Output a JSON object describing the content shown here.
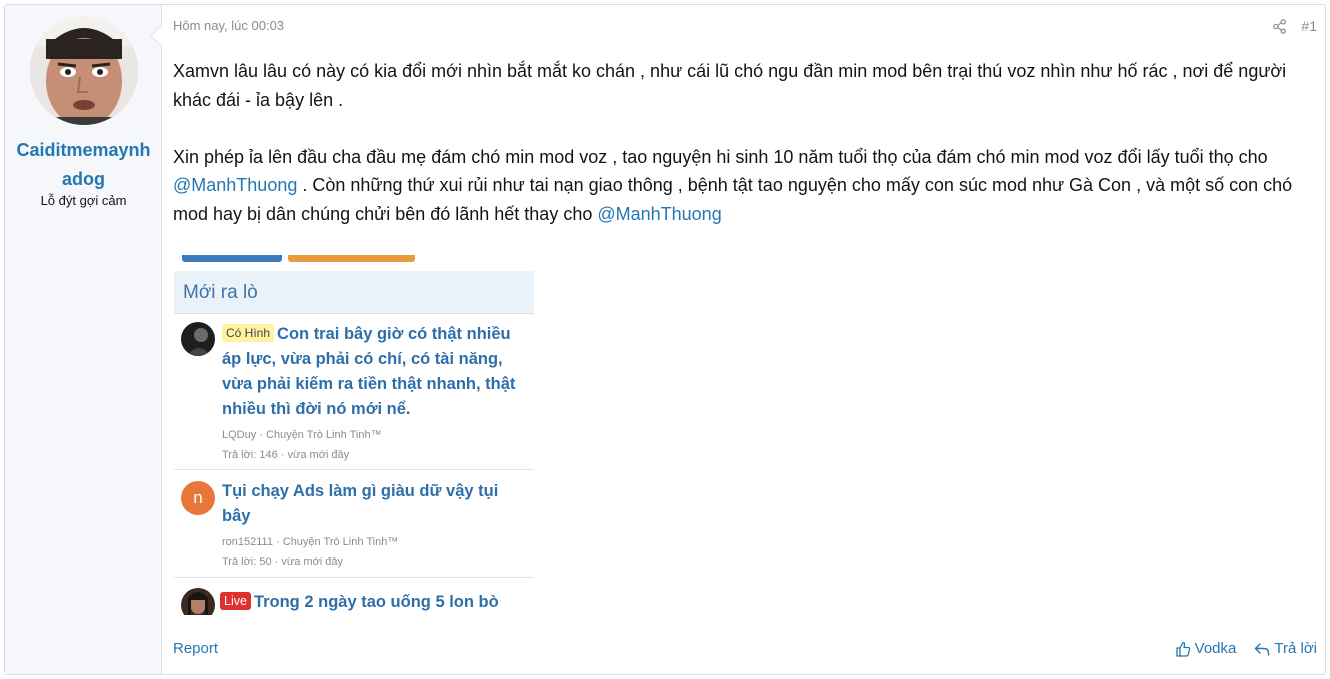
{
  "user": {
    "name": "Caiditmemaynhadog",
    "title": "Lỗ đýt gợi cảm"
  },
  "post": {
    "date": "Hôm nay, lúc 00:03",
    "number": "#1",
    "paragraph1": "Xamvn lâu lâu có này có kia đổi mới nhìn bắt mắt ko chán , như cái lũ chó ngu đần min mod bên trại thú voz nhìn như hố rác , nơi để người khác đái - ỉa bậy lên .",
    "paragraph2_part1": "Xin phép ỉa lên đầu cha đầu mẹ đám chó min mod voz , tao nguyện hi sinh 10 năm tuổi thọ của đám chó min mod voz đổi lấy tuổi thọ cho ",
    "mention1": "@ManhThuong",
    "paragraph2_part2": " . Còn những thứ xui rủi như tai nạn giao thông , bệnh tật tao nguyện cho mấy con súc mod như Gà Con , và một số con chó mod hay bị dân chúng chửi bên đó lãnh hết thay cho ",
    "mention2": "@ManhThuong"
  },
  "embed": {
    "header": "Mới ra lò",
    "threads": [
      {
        "badge": "Có Hình",
        "title": "Con trai bây giờ có thật nhiều áp lực, vừa phải có chí, có tài năng, vừa phải kiếm ra tiền thật nhanh, thật nhiều thì đời nó mới nể.",
        "author_forum": "LQDuy · Chuyện Trò Linh Tinh™",
        "replies": "Trả lời: 146 · vừa mới đây"
      },
      {
        "avatar_letter": "n",
        "title": "Tụi chạy Ads làm gì giàu dữ vậy tụi bây",
        "author_forum": "ron152111 · Chuyện Trò Linh Tinh™",
        "replies": "Trả lời: 50 · vừa mới đây"
      },
      {
        "badge": "Live",
        "title": "Trong 2 ngày tao uống 5 lon bò"
      }
    ]
  },
  "footer": {
    "report": "Report",
    "like": "Vodka",
    "reply": "Trả lời"
  },
  "colors": {
    "link": "#2577b1",
    "embed_link": "#2f6fa9",
    "sidebar_bg": "#f5f7fa"
  }
}
